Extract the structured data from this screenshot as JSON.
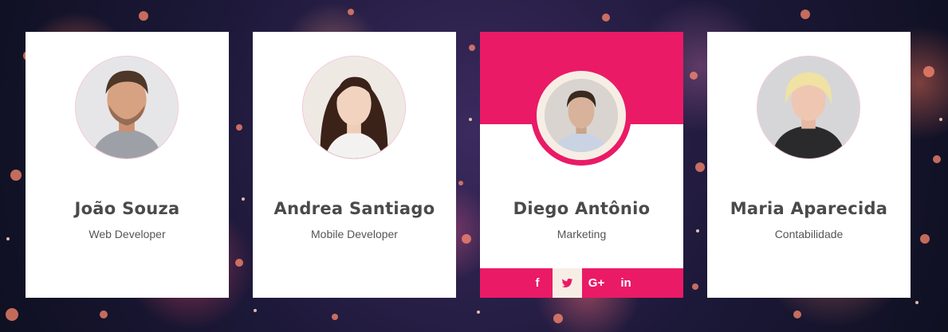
{
  "colors": {
    "accent": "#ea1a66",
    "cream": "#f6eee5",
    "text": "#4a4a4a"
  },
  "team": [
    {
      "name": "João Souza",
      "role": "Web Developer",
      "avatar_icon": "man-avatar-icon"
    },
    {
      "name": "Andrea Santiago",
      "role": "Mobile Developer",
      "avatar_icon": "woman-avatar-icon"
    },
    {
      "name": "Diego Antônio",
      "role": "Marketing",
      "avatar_icon": "man-avatar-icon",
      "social": [
        {
          "icon": "facebook-icon",
          "label": "f"
        },
        {
          "icon": "twitter-icon",
          "label": ""
        },
        {
          "icon": "google-plus-icon",
          "label": "G+"
        },
        {
          "icon": "linkedin-icon",
          "label": "in"
        }
      ]
    },
    {
      "name": "Maria Aparecida",
      "role": "Contabilidade",
      "avatar_icon": "woman-avatar-icon"
    }
  ]
}
